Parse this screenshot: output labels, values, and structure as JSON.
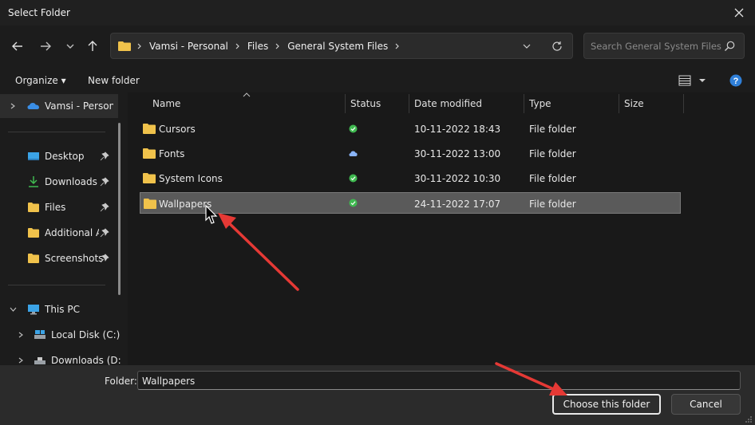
{
  "window": {
    "title": "Select Folder"
  },
  "nav": {
    "breadcrumbs": [
      "Vamsi - Personal",
      "Files",
      "General System Files"
    ],
    "search_placeholder": "Search General System Files"
  },
  "commands": {
    "organize": "Organize",
    "new_folder": "New folder"
  },
  "sidebar": {
    "cloud": "Vamsi - Persona",
    "quick": [
      {
        "label": "Desktop",
        "icon": "desktop-icon"
      },
      {
        "label": "Downloads",
        "icon": "download-icon"
      },
      {
        "label": "Files",
        "icon": "folder-icon"
      },
      {
        "label": "Additional A:",
        "icon": "folder-icon"
      },
      {
        "label": "Screenshots",
        "icon": "folder-icon"
      }
    ],
    "this_pc": "This PC",
    "drives": [
      {
        "label": "Local Disk (C:)",
        "icon": "drive-icon"
      },
      {
        "label": "Downloads (D:",
        "icon": "drive-icon"
      }
    ]
  },
  "columns": {
    "name": "Name",
    "status": "Status",
    "date": "Date modified",
    "type": "Type",
    "size": "Size"
  },
  "rows": [
    {
      "name": "Cursors",
      "status": "synced",
      "date": "10-11-2022 18:43",
      "type": "File folder",
      "size": ""
    },
    {
      "name": "Fonts",
      "status": "cloud",
      "date": "30-11-2022 13:00",
      "type": "File folder",
      "size": ""
    },
    {
      "name": "System Icons",
      "status": "synced",
      "date": "30-11-2022 10:30",
      "type": "File folder",
      "size": ""
    },
    {
      "name": "Wallpapers",
      "status": "synced",
      "date": "24-11-2022 17:07",
      "type": "File folder",
      "size": "",
      "selected": true
    }
  ],
  "footer": {
    "folder_label": "Folder:",
    "folder_value": "Wallpapers",
    "choose_button": "Choose this folder",
    "cancel_button": "Cancel"
  },
  "colors": {
    "accent": "#0078d4",
    "folder": "#f0c24b",
    "annotation_arrow": "#e53935",
    "status_green": "#3fb950",
    "cloud_blue": "#8ab4f8"
  }
}
